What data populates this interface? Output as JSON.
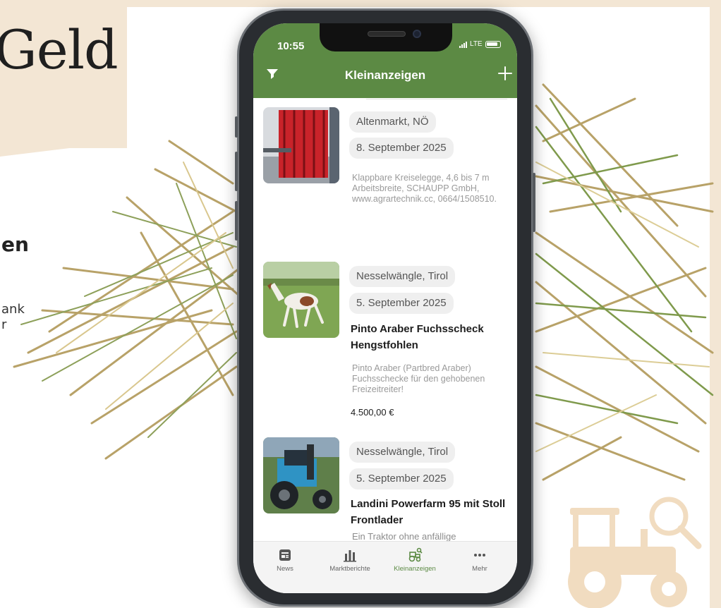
{
  "background": {
    "headline": "Geld",
    "subheading": "en",
    "side_text": [
      "ank",
      "r"
    ]
  },
  "status_bar": {
    "time": "10:55",
    "network": "LTE"
  },
  "app_header": {
    "title": "Kleinanzeigen"
  },
  "listings": [
    {
      "location": "Altenmarkt, NÖ",
      "date": "8. September 2025",
      "title": "",
      "description": "Klappbare Kreiselegge, 4,6 bis 7 m Arbeitsbreite, SCHAUPP GmbH, www.agrartechnik.cc, 0664/1508510.",
      "price": ""
    },
    {
      "location": "Nesselwängle, Tirol",
      "date": "5. September 2025",
      "title": "Pinto Araber Fuchsscheck Hengstfohlen",
      "description": "Pinto Araber (Partbred Araber) Fuchsschecke für den gehobenen Freizeitreiter!",
      "price": "4.500,00 €"
    },
    {
      "location": "Nesselwängle, Tirol",
      "date": "5. September 2025",
      "title": "Landini Powerfarm 95 mit Stoll Frontlader",
      "description": "Ein Traktor ohne anfällige",
      "price": ""
    }
  ],
  "tabbar": {
    "items": [
      {
        "label": "News",
        "icon": "newspaper-icon"
      },
      {
        "label": "Marktberichte",
        "icon": "bar-chart-icon"
      },
      {
        "label": "Kleinanzeigen",
        "icon": "tractor-icon",
        "active": true
      },
      {
        "label": "Mehr",
        "icon": "more-dots-icon"
      }
    ]
  },
  "colors": {
    "brand_green": "#5c8a44",
    "background_beige": "#f3e6d4"
  }
}
